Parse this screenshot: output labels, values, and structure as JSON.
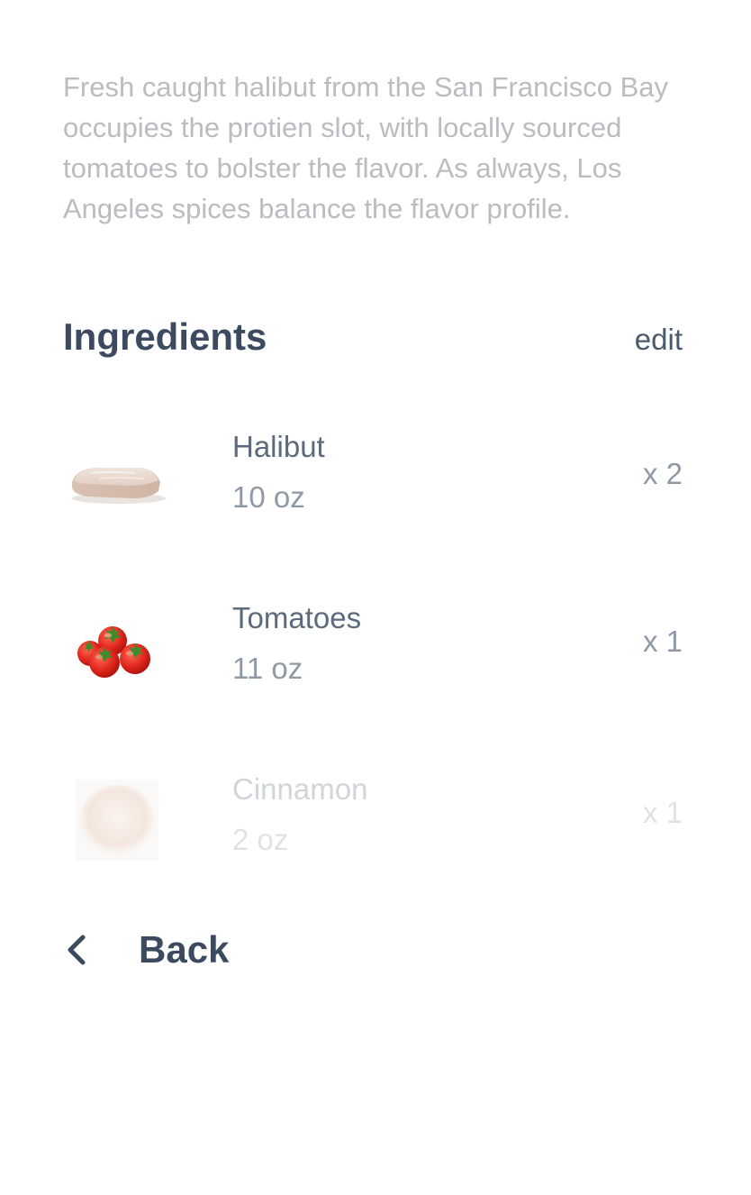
{
  "recipe": {
    "description": "Fresh caught halibut from the San Francisco Bay occupies the protien slot, with locally sourced tomatoes to bolster the flavor. As always, Los Angeles spices balance the flavor profile."
  },
  "ingredients": {
    "title": "Ingredients",
    "edit_label": "edit",
    "items": [
      {
        "name": "Halibut",
        "amount": "10 oz",
        "quantity": "x 2",
        "icon": "halibut-fillet-image"
      },
      {
        "name": "Tomatoes",
        "amount": "11 oz",
        "quantity": "x 1",
        "icon": "tomatoes-image"
      },
      {
        "name": "Cinnamon",
        "amount": "2 oz",
        "quantity": "x 1",
        "icon": "cinnamon-powder-image"
      }
    ]
  },
  "navigation": {
    "back_label": "Back",
    "back_icon": "chevron-left-icon"
  }
}
